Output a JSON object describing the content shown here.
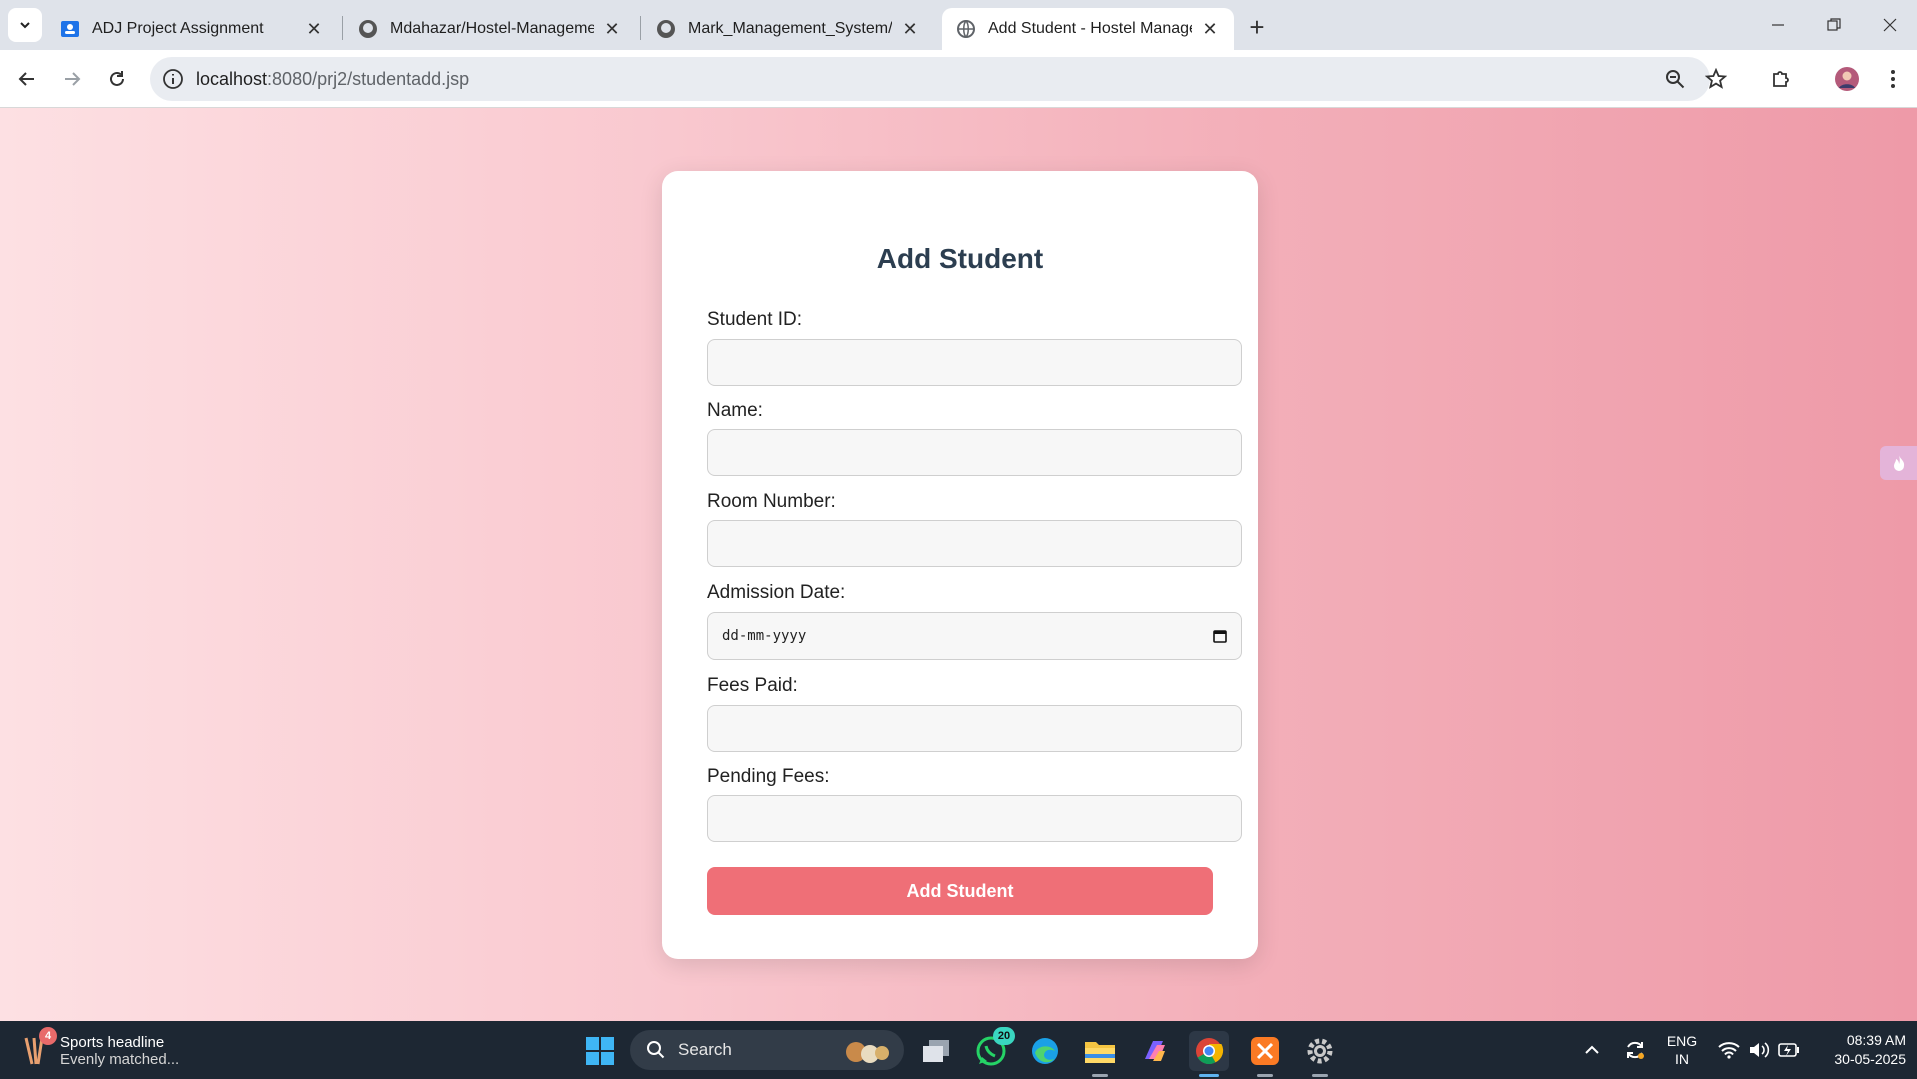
{
  "browser": {
    "tabs": [
      {
        "title": "ADJ Project Assignment",
        "icon": "google-classroom-icon"
      },
      {
        "title": "Mdahazar/Hostel-Management",
        "icon": "github-icon"
      },
      {
        "title": "Mark_Management_System/out",
        "icon": "github-icon"
      },
      {
        "title": "Add Student - Hostel Managem",
        "icon": "globe-icon",
        "active": true
      }
    ],
    "new_tab_symbol": "+",
    "close_symbol": "✕",
    "url_host": "localhost",
    "url_path": ":8080/prj2/studentadd.jsp"
  },
  "form": {
    "title": "Add Student",
    "fields": [
      {
        "label": "Student ID:",
        "value": ""
      },
      {
        "label": "Name:",
        "value": ""
      },
      {
        "label": "Room Number:",
        "value": ""
      },
      {
        "label": "Admission Date:",
        "placeholder": "dd-mm-yyyy"
      },
      {
        "label": "Fees Paid:",
        "value": ""
      },
      {
        "label": "Pending Fees:",
        "value": ""
      }
    ],
    "submit_label": "Add Student"
  },
  "taskbar": {
    "news_headline": "Sports headline",
    "news_subtitle": "Evenly matched...",
    "news_badge": "4",
    "search_label": "Search",
    "whatsapp_badge": "20",
    "language": "ENG",
    "region": "IN",
    "time": "08:39 AM",
    "date": "30-05-2025"
  },
  "colors": {
    "accent_button": "#ef6f77",
    "title": "#2c3e50"
  }
}
